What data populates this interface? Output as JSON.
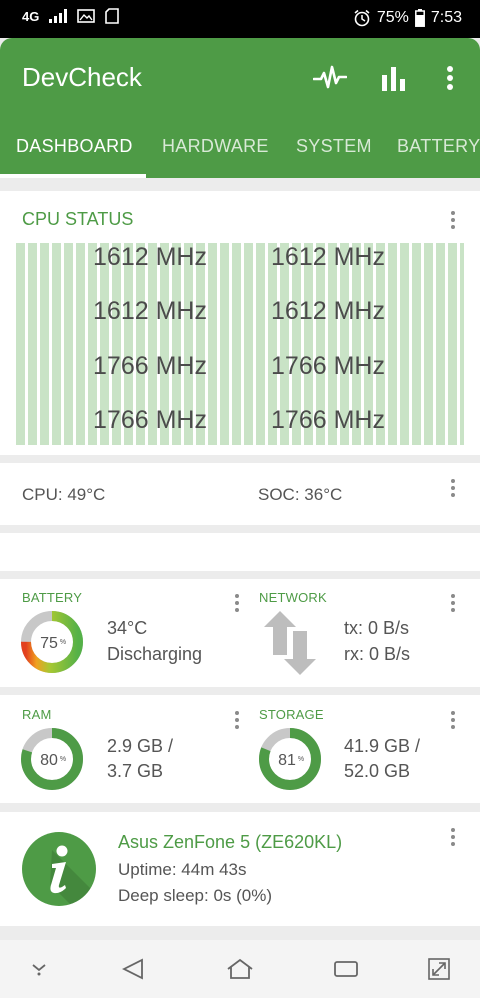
{
  "status_bar": {
    "network": "4G",
    "battery": "75%",
    "time": "7:53"
  },
  "app": {
    "title": "DevCheck"
  },
  "tabs": [
    {
      "label": "DASHBOARD",
      "active": true
    },
    {
      "label": "HARDWARE"
    },
    {
      "label": "SYSTEM"
    },
    {
      "label": "BATTERY"
    }
  ],
  "cpu_status": {
    "title": "CPU STATUS",
    "cores": [
      "1612 MHz",
      "1612 MHz",
      "1612 MHz",
      "1612 MHz",
      "1766 MHz",
      "1766 MHz",
      "1766 MHz",
      "1766 MHz"
    ]
  },
  "temps": {
    "cpu": "CPU: 49°C",
    "soc": "SOC: 36°C"
  },
  "battery": {
    "label": "BATTERY",
    "percent": 75,
    "percent_text": "75",
    "temp": "34°C",
    "state": "Discharging"
  },
  "network": {
    "label": "NETWORK",
    "tx": "tx: 0 B/s",
    "rx": "rx: 0 B/s"
  },
  "ram": {
    "label": "RAM",
    "percent": 80,
    "percent_text": "80",
    "used": "2.9 GB /",
    "total": "3.7 GB"
  },
  "storage": {
    "label": "STORAGE",
    "percent": 81,
    "percent_text": "81",
    "used": "41.9 GB /",
    "total": "52.0 GB"
  },
  "device": {
    "name": "Asus ZenFone 5 (ZE620KL)",
    "uptime": "Uptime: 44m 43s",
    "deep_sleep": "Deep sleep: 0s (0%)"
  },
  "colors": {
    "accent": "#4e9b46",
    "bar_fill": "#c9e3c6"
  },
  "icons": {
    "appbar": [
      "pulse-icon",
      "bar-chart-icon",
      "more-vert-icon"
    ],
    "nav": [
      "nav-down-icon",
      "back-icon",
      "home-icon",
      "recents-icon",
      "expand-icon"
    ]
  }
}
